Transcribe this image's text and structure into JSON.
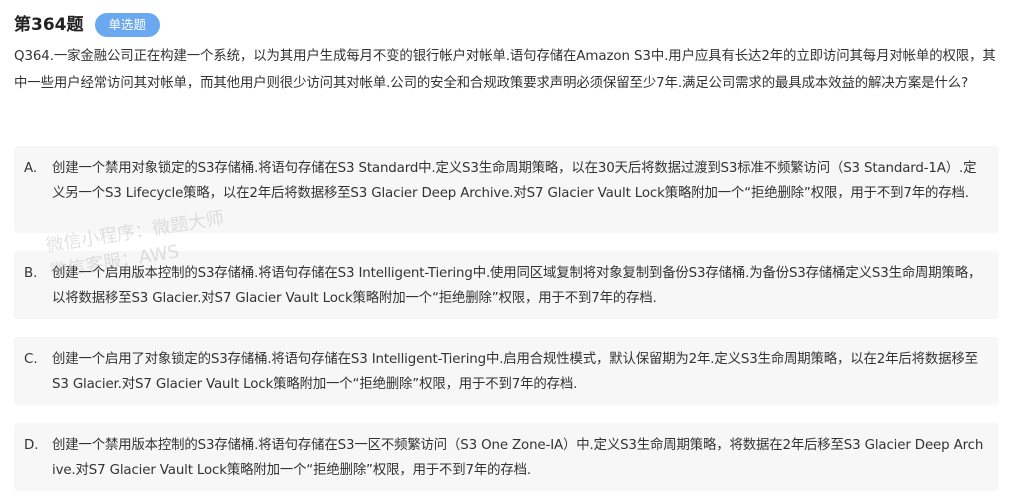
{
  "question": {
    "number": "第364题",
    "type_badge": "单选题",
    "stem": "Q364.一家金融公司正在构建一个系统，以为其用户生成每月不变的银行帐户对帐单.语句存储在Amazon S3中.用户应具有长达2年的立即访问其每月对帐单的权限，其中一些用户经常访问其对帐单，而其他用户则很少访问其对帐单.公司的安全和合规政策要求声明必须保留至少7年.满足公司需求的最具成本效益的解决方案是什么?"
  },
  "options": [
    {
      "letter": "A.",
      "text": "创建一个禁用对象锁定的S3存储桶.将语句存储在S3 Standard中.定义S3生命周期策略，以在30天后将数据过渡到S3标准不频繁访问（S3 Standard-1A）.定义另一个S3 Lifecycle策略，以在2年后将数据移至S3 Glacier Deep Archive.对S7 Glacier Vault Lock策略附加一个“拒绝删除”权限，用于不到7年的存档."
    },
    {
      "letter": "B.",
      "text": "创建一个启用版本控制的S3存储桶.将语句存储在S3 Intelligent-Tiering中.使用同区域复制将对象复制到备份S3存储桶.为备份S3存储桶定义S3生命周期策略，以将数据移至S3 Glacier.对S7 Glacier Vault Lock策略附加一个“拒绝删除”权限，用于不到7年的存档."
    },
    {
      "letter": "C.",
      "text": "创建一个启用了对象锁定的S3存储桶.将语句存储在S3 Intelligent-Tiering中.启用合规性模式，默认保留期为2年.定义S3生命周期策略，以在2年后将数据移至S3 Glacier.对S7 Glacier Vault Lock策略附加一个“拒绝删除”权限，用于不到7年的存档."
    },
    {
      "letter": "D.",
      "text": "创建一个禁用版本控制的S3存储桶.将语句存储在S3一区不频繁访问（S3 One Zone-IA）中.定义S3生命周期策略，将数据在2年后移至S3 Glacier Deep Archive.对S7 Glacier Vault Lock策略附加一个“拒绝删除”权限，用于不到7年的存档."
    }
  ],
  "watermark": {
    "line1": "微信小程序：微题大师",
    "line2": "微信客服：AWS"
  },
  "colors": {
    "badge_bg": "#6aa8ef",
    "option_bg": "#f7f7f7",
    "text": "#333333"
  }
}
